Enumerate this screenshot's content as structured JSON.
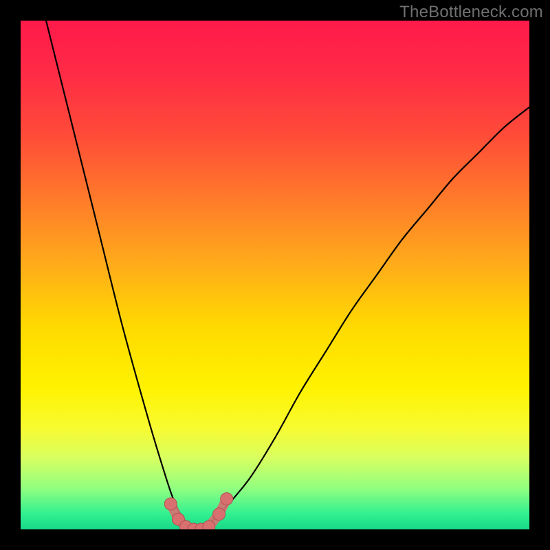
{
  "watermark": "TheBottleneck.com",
  "colors": {
    "frame": "#000000",
    "gradient_stops": [
      {
        "offset": 0.0,
        "color": "#ff1a4a"
      },
      {
        "offset": 0.1,
        "color": "#ff2a46"
      },
      {
        "offset": 0.22,
        "color": "#ff4a39"
      },
      {
        "offset": 0.35,
        "color": "#ff7a2a"
      },
      {
        "offset": 0.48,
        "color": "#ffac1a"
      },
      {
        "offset": 0.6,
        "color": "#ffd900"
      },
      {
        "offset": 0.72,
        "color": "#fff200"
      },
      {
        "offset": 0.8,
        "color": "#f8fb30"
      },
      {
        "offset": 0.86,
        "color": "#d8ff60"
      },
      {
        "offset": 0.92,
        "color": "#90ff80"
      },
      {
        "offset": 0.97,
        "color": "#30f090"
      },
      {
        "offset": 1.0,
        "color": "#18d888"
      }
    ],
    "curve": "#000000",
    "markers_fill": "#d87070",
    "markers_stroke": "#b05050"
  },
  "chart_data": {
    "type": "line",
    "title": "",
    "xlabel": "",
    "ylabel": "",
    "xlim": [
      0,
      100
    ],
    "ylim": [
      0,
      100
    ],
    "grid": false,
    "series": [
      {
        "name": "bottleneck-curve",
        "x": [
          5,
          10,
          15,
          20,
          25,
          28,
          30,
          32,
          34,
          36,
          38,
          40,
          45,
          50,
          55,
          60,
          65,
          70,
          75,
          80,
          85,
          90,
          95,
          100
        ],
        "y": [
          100,
          80,
          60,
          40,
          22,
          12,
          6,
          2,
          0,
          0,
          2,
          4,
          10,
          18,
          27,
          35,
          43,
          50,
          57,
          63,
          69,
          74,
          79,
          83
        ]
      }
    ],
    "annotations": [
      {
        "name": "valley-markers",
        "x": [
          29.5,
          31,
          32.5,
          34,
          35.5,
          37,
          39,
          40.5
        ],
        "y": [
          5,
          2,
          0.5,
          0,
          0,
          0.5,
          3,
          6
        ]
      }
    ]
  }
}
